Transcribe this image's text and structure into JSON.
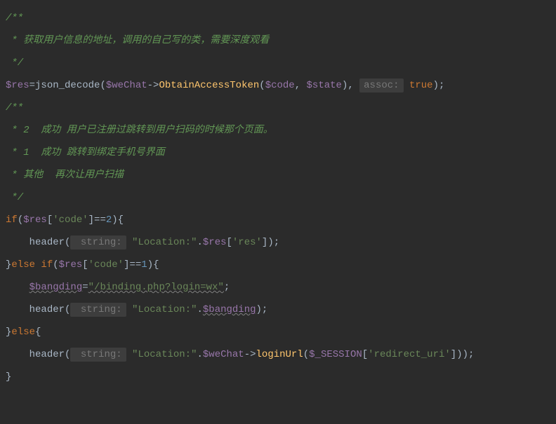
{
  "lines": {
    "l1": "/**",
    "l2": " * 获取用户信息的地址，调用的自己写的类，需要深度观看",
    "l3": " */",
    "l4_var": "$res",
    "l4_eq": "=",
    "l4_jsondecode": "json_decode",
    "l4_lparen": "(",
    "l4_wechat": "$weChat",
    "l4_arrow": "->",
    "l4_obtain": "ObtainAccessToken",
    "l4_lparen2": "(",
    "l4_code": "$code",
    "l4_comma": ",",
    "l4_state": " $state",
    "l4_rparen": "),",
    "l4_hint": "assoc:",
    "l4_true": " true",
    "l4_end": ");",
    "l5": "/**",
    "l6": " * 2  成功 用户已注册过跳转到用户扫码的时候那个页面。",
    "l7": " * 1  成功 跳转到绑定手机号界面",
    "l8": " * 其他  再次让用户扫描",
    "l9": " */",
    "l10_if": "if",
    "l10_lparen": "(",
    "l10_res": "$res",
    "l10_lbrack": "[",
    "l10_codestr": "'code'",
    "l10_rbrack": "]==",
    "l10_num": "2",
    "l10_end": "){",
    "l11_indent": "    ",
    "l11_header": "header",
    "l11_lparen": "(",
    "l11_hint": " string:",
    "l11_loc": " \"Location:\"",
    "l11_dot": ".",
    "l11_res": "$res",
    "l11_lbrack": "[",
    "l11_resstr": "'res'",
    "l11_end": "]);",
    "l12_rbrace": "}",
    "l12_else": "else ",
    "l12_if": "if",
    "l12_lparen": "(",
    "l12_res": "$res",
    "l12_lbrack": "[",
    "l12_codestr": "'code'",
    "l12_rbrack": "]==",
    "l12_num": "1",
    "l12_end": "){",
    "l13_indent": "    ",
    "l13_bang": "$bangding",
    "l13_eq": "=",
    "l13_str": "\"/binding.php?login=wx\"",
    "l13_end": ";",
    "l14_indent": "    ",
    "l14_header": "header",
    "l14_lparen": "(",
    "l14_hint": " string:",
    "l14_loc": " \"Location:\"",
    "l14_dot": ".",
    "l14_bang": "$bangding",
    "l14_end": ");",
    "l15_rbrace": "}",
    "l15_else": "else",
    "l15_end": "{",
    "l16_indent": "    ",
    "l16_header": "header",
    "l16_lparen": "(",
    "l16_hint": " string:",
    "l16_loc": " \"Location:\"",
    "l16_dot": ".",
    "l16_wechat": "$weChat",
    "l16_arrow": "->",
    "l16_login": "loginUrl",
    "l16_lparen2": "(",
    "l16_session": "$_SESSION",
    "l16_lbrack": "[",
    "l16_reduri": "'redirect_uri'",
    "l16_end": "]));",
    "l17": "}"
  }
}
